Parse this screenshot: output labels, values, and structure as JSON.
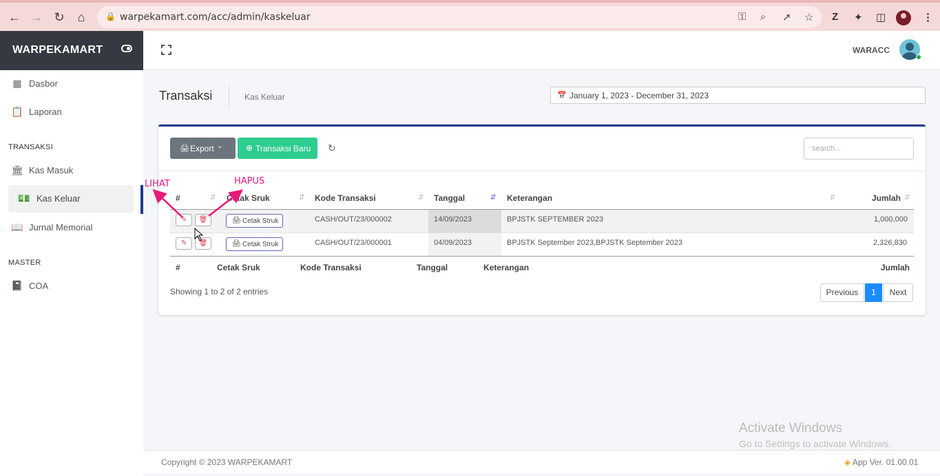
{
  "browser": {
    "url": "warpekamart.com/acc/admin/kaskeluar"
  },
  "sidebar": {
    "brand": "WARPEKAMART",
    "items": [
      {
        "label": "Dasbor"
      },
      {
        "label": "Laporan"
      },
      {
        "label": "Kas Masuk"
      },
      {
        "label": "Kas Keluar"
      },
      {
        "label": "Jurnal Memorial"
      },
      {
        "label": "COA"
      }
    ],
    "headers": [
      "TRANSAKSI",
      "MASTER"
    ]
  },
  "topnav": {
    "user": "WARACC"
  },
  "header": {
    "title": "Transaksi",
    "breadcrumb": "Kas Keluar",
    "daterange": "January 1, 2023 - December 31, 2023"
  },
  "toolbar": {
    "export_label": "Export",
    "new_label": "Transaksi Baru",
    "search_placeholder": "search..."
  },
  "table": {
    "columns": [
      "#",
      "Cetak Sruk",
      "Kode Transaksi",
      "Tanggal",
      "Keterangan",
      "Jumlah"
    ],
    "print_label": "Cetak Struk",
    "rows": [
      {
        "kode": "CASH/OUT/23/000002",
        "tanggal": "14/09/2023",
        "keterangan": "BPJSTK SEPTEMBER 2023",
        "jumlah": "1,000,000"
      },
      {
        "kode": "CASH/OUT/23/000001",
        "tanggal": "04/09/2023",
        "keterangan": "BPJSTK September 2023,BPJSTK September 2023",
        "jumlah": "2,326,830"
      }
    ],
    "info": "Showing 1 to 2 of 2 entries",
    "pagination": {
      "previous": "Previous",
      "current": "1",
      "next": "Next"
    }
  },
  "annotations": {
    "left": "LIHAT",
    "right": "HAPUS",
    "color": "#e8197a"
  },
  "watermark": {
    "line1": "Activate Windows",
    "line2": "Go to Settings to activate Windows."
  },
  "footer": {
    "copyright": "Copyright © 2023 WARPEKAMART",
    "version": "App Ver. 01.00.01"
  },
  "colors": {
    "accent": "#1e3a8a",
    "success": "#2ecc8f",
    "sidebar_dark": "#343a40",
    "page_active": "#1a8cff"
  }
}
